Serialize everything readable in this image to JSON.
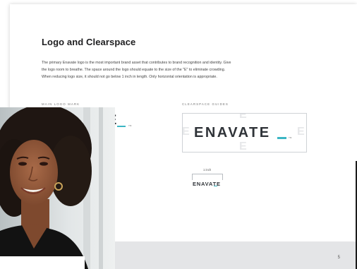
{
  "title": "Logo and Clearspace",
  "body": [
    "The primary Enavate logo is the most important brand asset that contributes to brand recognition and identity. Give",
    "the logo room to breathe. The space around the logo should equate to the size of the \"E\" to eliminate crowding.",
    "When reducing logo size, it should not go below 1 inch in length. Only horizontal orientation is appropriate."
  ],
  "labels": {
    "main_logo_mark": "MAIN LOGO MARK",
    "clearspace_guides": "CLEARSPACE GUIDES"
  },
  "logo": {
    "wordmark": "ENAVATE",
    "partial": "TE",
    "trademark": "TM",
    "ghost_letter": "E"
  },
  "size_guide": {
    "label": "1 inch"
  },
  "page_number": "5",
  "colors": {
    "accent": "#3cb6c4",
    "logo": "#2f3338",
    "footer": "#e4e5e7"
  }
}
